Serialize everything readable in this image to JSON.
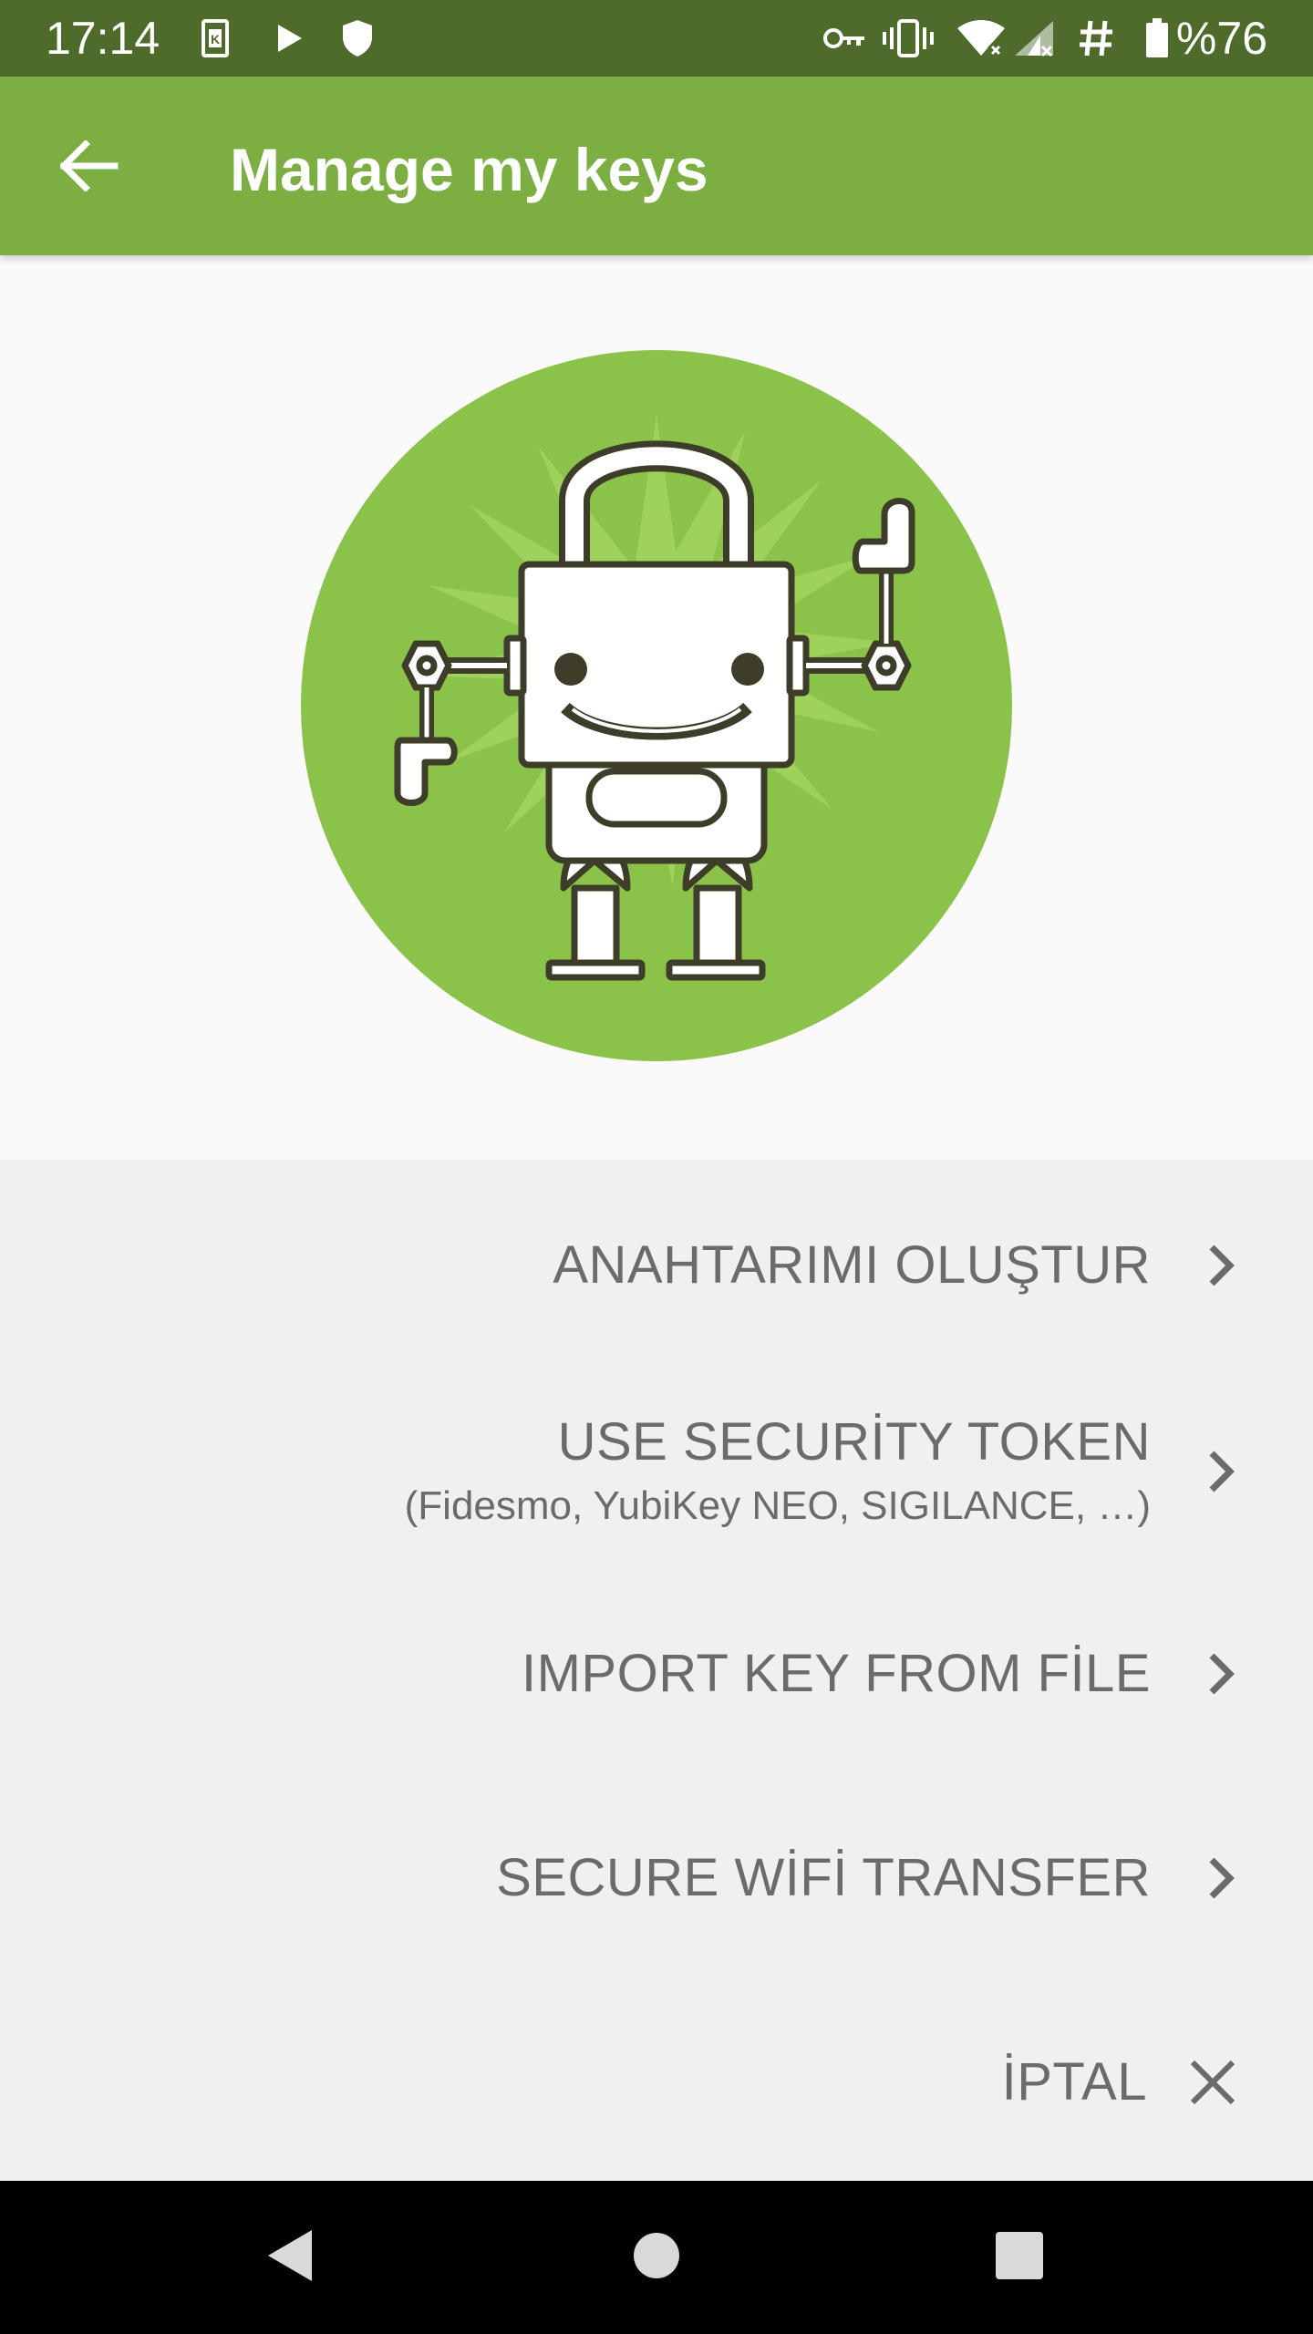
{
  "status_bar": {
    "time": "17:14",
    "battery_text": "%76",
    "icons": [
      "k-notification-icon",
      "play-store-icon",
      "shield-icon",
      "vpn-key-icon",
      "vibrate-icon",
      "wifi-off-icon",
      "cell-signal-icon",
      "hash-icon",
      "battery-icon"
    ]
  },
  "app_bar": {
    "title": "Manage my keys",
    "back_icon": "arrow-back-icon"
  },
  "colors": {
    "status_bar": "#4e6b2c",
    "app_bar": "#7cae42",
    "hero_circle": "#8bc34a",
    "robot_outline": "#3d3d2a",
    "menu_text": "#6b6b6b",
    "menu_bg": "#f0f0f0"
  },
  "menu": {
    "create_key": "ANAHTARIMI OLUŞTUR",
    "security_token": "USE SECURİTY TOKEN",
    "security_token_sub": "(Fidesmo, YubiKey NEO, SIGILANCE, …)",
    "import_file": "IMPORT KEY FROM FİLE",
    "wifi_transfer": "SECURE WİFİ TRANSFER",
    "cancel": "İPTAL"
  },
  "nav_bar": {
    "back": "nav-back-icon",
    "home": "nav-home-icon",
    "recents": "nav-recents-icon"
  }
}
